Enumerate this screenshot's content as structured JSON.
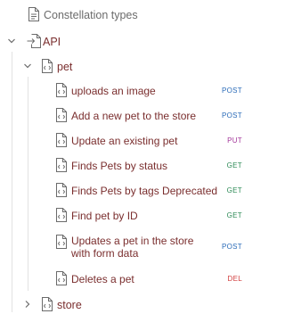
{
  "tree": {
    "top_item": {
      "label": "Constellation types",
      "icon": "file-icon"
    },
    "root": {
      "label": "API",
      "icon": "import-icon",
      "expanded": true
    },
    "pet_folder": {
      "label": "pet",
      "icon": "file-code-icon",
      "expanded": true
    },
    "store_folder": {
      "label": "store",
      "icon": "file-code-icon",
      "expanded": false
    },
    "operations": [
      {
        "label": "uploads an image",
        "method": "POST",
        "method_color": "#2a6bb8"
      },
      {
        "label": "Add a new pet to the store",
        "method": "POST",
        "method_color": "#2a6bb8"
      },
      {
        "label": "Update an existing pet",
        "method": "PUT",
        "method_color": "#a3379a"
      },
      {
        "label": "Finds Pets by status",
        "method": "GET",
        "method_color": "#2e8b57"
      },
      {
        "label": "Finds Pets by tags Deprecated",
        "method": "GET",
        "method_color": "#2e8b57"
      },
      {
        "label": "Find pet by ID",
        "method": "GET",
        "method_color": "#2e8b57"
      },
      {
        "label": "Updates a pet in the store with form data",
        "method": "POST",
        "method_color": "#2a6bb8"
      },
      {
        "label": "Deletes a pet",
        "method": "DEL",
        "method_color": "#d13c3c"
      }
    ]
  },
  "colors": {
    "label_text": "#7a2e2e",
    "muted_text": "#6b6b6b",
    "icon_stroke": "#6b6b6b"
  }
}
